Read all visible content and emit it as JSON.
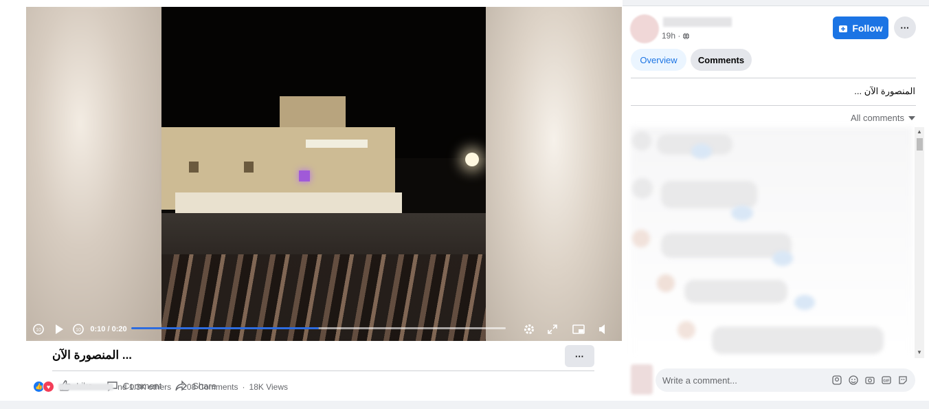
{
  "video": {
    "time_current": "0:10",
    "time_total": "0:20",
    "progress_fraction": 0.5,
    "time_display": "0:10 / 0:20"
  },
  "post": {
    "caption": "المنصورة الآن ...",
    "more_label": "···"
  },
  "actions": {
    "like": "Like",
    "comment": "Comment",
    "share": "Share"
  },
  "stats": {
    "others": "nd 1.3K others",
    "comments": "208 Comments",
    "views": "18K Views",
    "sep": "·"
  },
  "author": {
    "time": "19h ·"
  },
  "header": {
    "follow_label": "Follow",
    "more_label": "···"
  },
  "tabs": [
    {
      "label": "Overview"
    },
    {
      "label": "Comments"
    }
  ],
  "side_post_text": "المنصورة الآن ...",
  "comments_filter": "All comments",
  "comment_box": {
    "placeholder": "Write a comment..."
  },
  "colors": {
    "accent": "#1b74e4",
    "progress": "#2d6cdf",
    "like": "#1877f2",
    "love": "#f33e58"
  },
  "icons": [
    "rewind-10-icon",
    "play-icon",
    "forward-10-icon",
    "settings-icon",
    "fullscreen-icon",
    "miniplayer-icon",
    "volume-icon",
    "like-icon",
    "comment-icon",
    "share-icon",
    "globe-icon",
    "follow-icon",
    "caret-down-icon",
    "avatar-sticker-icon",
    "emoji-icon",
    "camera-icon",
    "gif-icon",
    "sticker-icon"
  ]
}
